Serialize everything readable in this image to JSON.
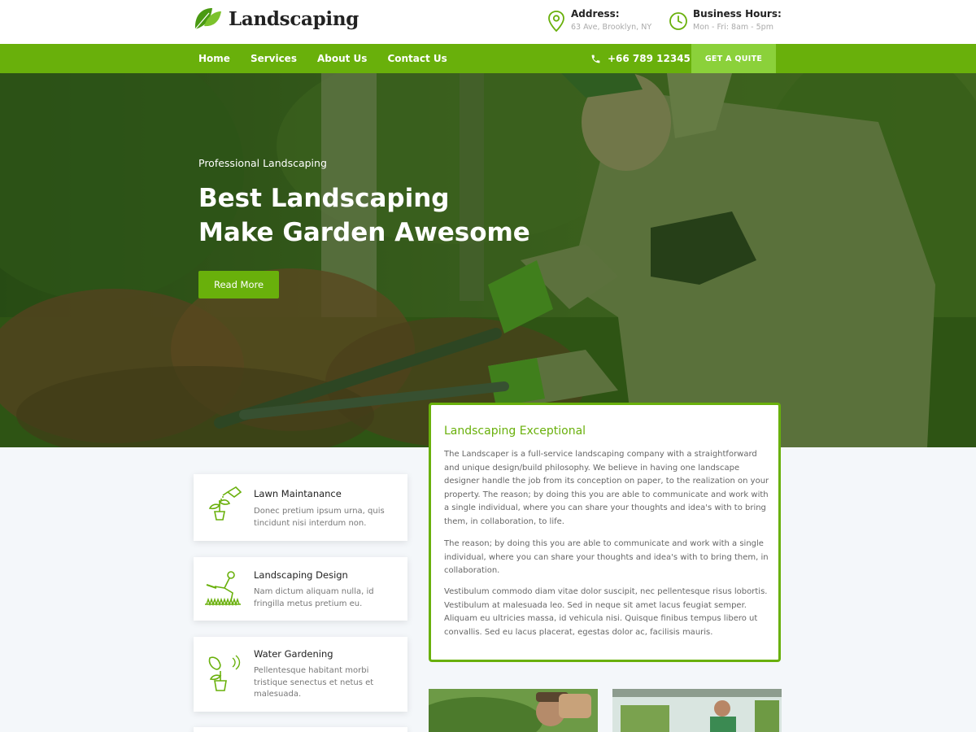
{
  "brand": {
    "name": "Landscaping",
    "accent": "#69b00b",
    "accent_light": "#8bd13a"
  },
  "header": {
    "address": {
      "icon": "map-pin-icon",
      "title": "Address:",
      "value": "63 Ave, Brooklyn, NY"
    },
    "hours": {
      "icon": "clock-icon",
      "title": "Business Hours:",
      "value": "Mon - Fri: 8am - 5pm"
    }
  },
  "nav": {
    "links": [
      "Home",
      "Services",
      "About Us",
      "Contact Us"
    ],
    "phone": "+66 789 12345",
    "quote_label": "GET A QUITE"
  },
  "hero": {
    "eyebrow": "Professional Landscaping",
    "title_line1": "Best Landscaping",
    "title_line2": "Make Garden Awesome",
    "button": "Read More"
  },
  "services": [
    {
      "icon": "watering-plant-icon",
      "title": "Lawn Maintanance",
      "desc": "Donec pretium ipsum urna, quis tincidunt nisi interdum non."
    },
    {
      "icon": "gardener-icon",
      "title": "Landscaping Design",
      "desc": "Nam dictum aliquam nulla, id fringilla metus pretium eu."
    },
    {
      "icon": "sprinkler-plant-icon",
      "title": "Water Gardening",
      "desc": "Pellentesque habitant morbi tristique senectus et netus et malesuada."
    }
  ],
  "about": {
    "title": "Landscaping Exceptional",
    "p1": "The Landscaper is a full-service landscaping company with a straightforward and unique design/build philosophy. We believe in having one landscape designer handle the job from its conception on paper, to the realization on your property. The reason; by doing this you are able to communicate and work with a single individual, where you can share your thoughts and idea's with to bring them, in collaboration, to life.",
    "p2": "The reason; by doing this you are able to communicate and work with a single individual, where you can share your thoughts and idea's with to bring them, in collaboration.",
    "p3": "Vestibulum commodo diam vitae dolor suscipit, nec pellentesque risus lobortis. Vestibulum at malesuada leo. Sed in neque sit amet lacus feugiat semper. Aliquam eu ultricies massa, id vehicula nisi. Quisque finibus tempus libero ut convallis. Sed eu lacus placerat, egestas dolor ac, facilisis mauris."
  }
}
